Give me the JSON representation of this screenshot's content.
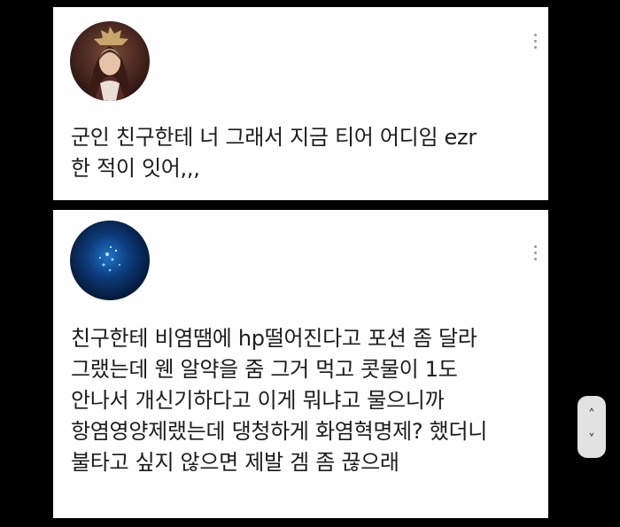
{
  "posts": [
    {
      "avatar_icon": "saint-portrait-avatar",
      "lines": [
        "군인 친구한테 너 그래서 지금 티어 어디임 ezr",
        "한 적이 잇어,,,"
      ]
    },
    {
      "avatar_icon": "underwater-light-avatar",
      "lines": [
        "친구한테 비염땜에 hp떨어진다고 포션 좀 달라",
        "그랬는데 웬 알약을 줌 그거 먹고 콧물이 1도",
        "안나서 개신기하다고 이게 뭐냐고 물으니까",
        "항염영양제랬는데 댕청하게 화염혁명제? 했더니",
        "불타고 싶지 않으면 제발 겜 좀 끊으래"
      ]
    }
  ],
  "scroll_control": {
    "up_icon": "chevron-up-icon",
    "down_icon": "chevron-down-icon",
    "up_glyph": "˄",
    "down_glyph": "˅"
  }
}
